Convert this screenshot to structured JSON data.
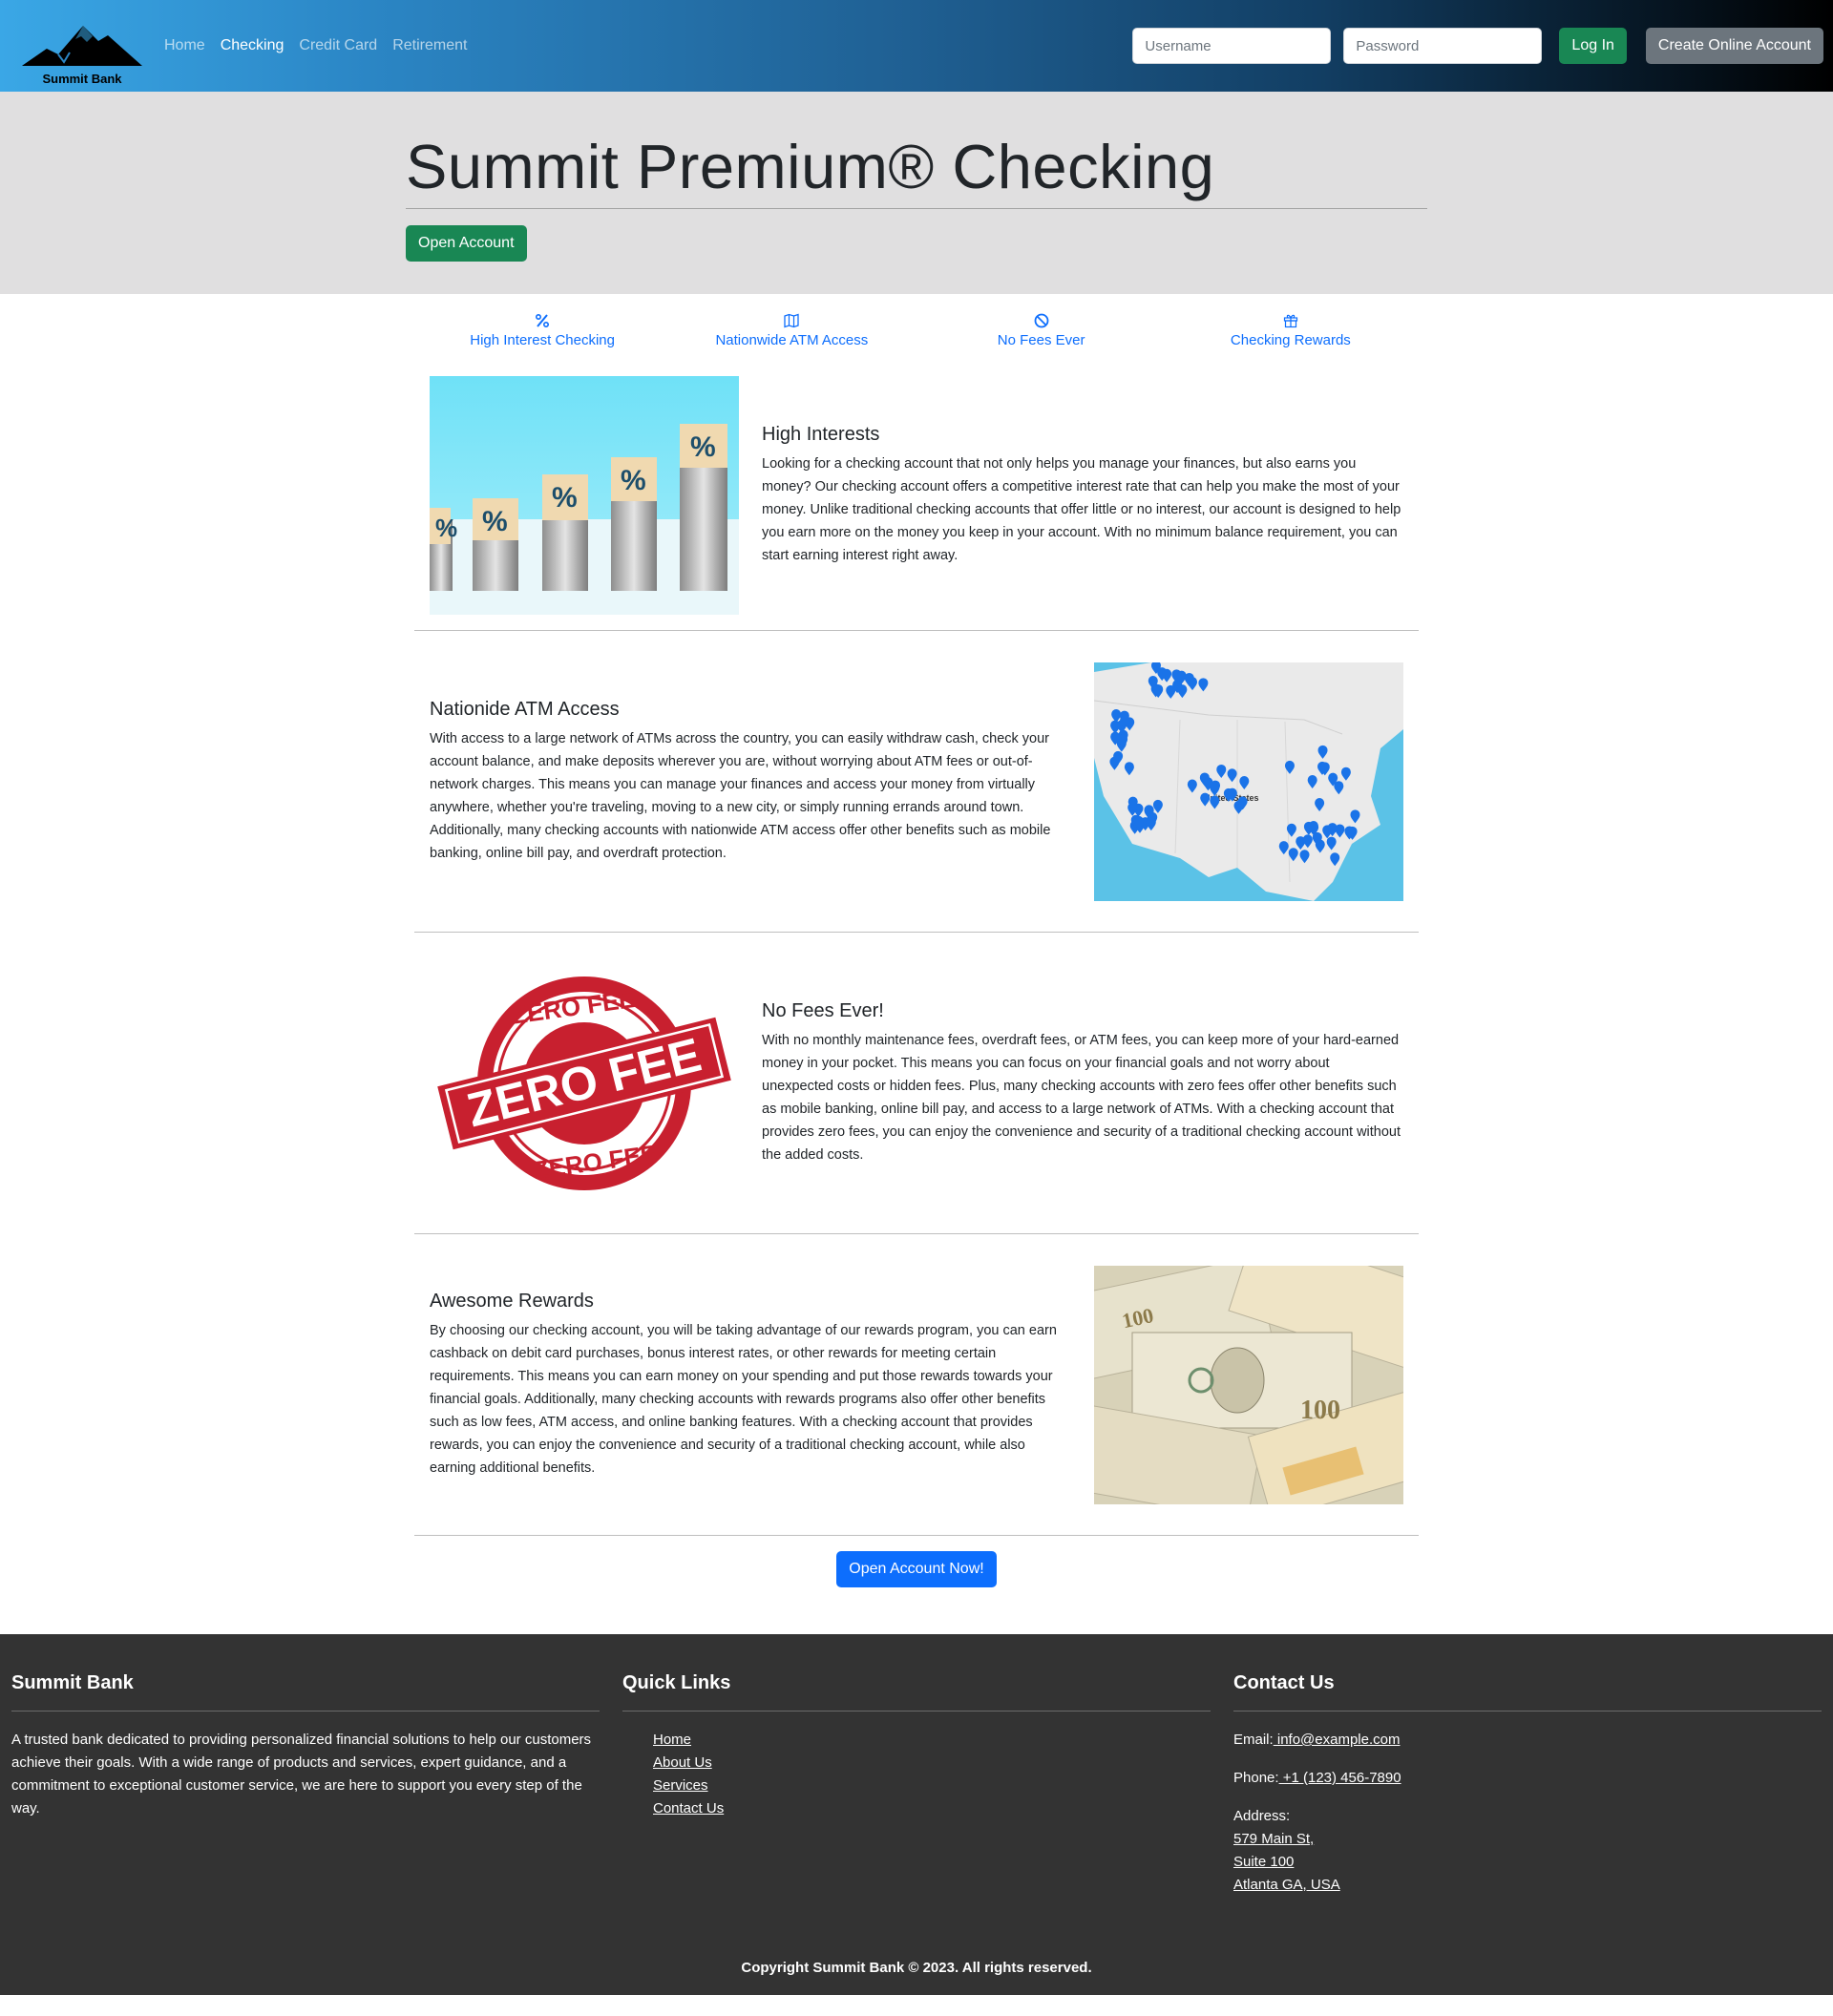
{
  "brand": {
    "name": "Summit Bank"
  },
  "nav": {
    "links": [
      {
        "label": "Home",
        "active": false
      },
      {
        "label": "Checking",
        "active": true
      },
      {
        "label": "Credit Card",
        "active": false
      },
      {
        "label": "Retirement",
        "active": false
      }
    ],
    "username_placeholder": "Username",
    "password_placeholder": "Password",
    "login_label": "Log In",
    "create_account_label": "Create Online Account"
  },
  "hero": {
    "title": "Summit Premium® Checking",
    "open_account_label": "Open Account"
  },
  "features": [
    {
      "label": "High Interest Checking",
      "icon": "percent-icon"
    },
    {
      "label": "Nationwide ATM Access",
      "icon": "map-icon"
    },
    {
      "label": "No Fees Ever",
      "icon": "ban-icon"
    },
    {
      "label": "Checking Rewards",
      "icon": "gift-icon"
    }
  ],
  "sections": [
    {
      "title": "High Interests",
      "body": "Looking for a checking account that not only helps you manage your finances, but also earns you money? Our checking account offers a competitive interest rate that can help you make the most of your money. Unlike traditional checking accounts that offer little or no interest, our account is designed to help you earn more on the money you keep in your account. With no minimum balance requirement, you can start earning interest right away.",
      "image": "coins-percent-image",
      "image_text": "%"
    },
    {
      "title": "Nationide ATM Access",
      "body": "With access to a large network of ATMs across the country, you can easily withdraw cash, check your account balance, and make deposits wherever you are, without worrying about ATM fees or out-of-network charges. This means you can manage your finances and access your money from virtually anywhere, whether you're traveling, moving to a new city, or simply running errands around town. Additionally, many checking accounts with nationwide ATM access offer other benefits such as mobile banking, online bill pay, and overdraft protection.",
      "image": "atm-map-image",
      "image_text": "United States"
    },
    {
      "title": "No Fees Ever!",
      "body": "With no monthly maintenance fees, overdraft fees, or ATM fees, you can keep more of your hard-earned money in your pocket. This means you can focus on your financial goals and not worry about unexpected costs or hidden fees. Plus, many checking accounts with zero fees offer other benefits such as mobile banking, online bill pay, and access to a large network of ATMs. With a checking account that provides zero fees, you can enjoy the convenience and security of a traditional checking account without the added costs.",
      "image": "zero-fee-stamp-image",
      "image_text": "ZERO FEE"
    },
    {
      "title": "Awesome Rewards",
      "body": "By choosing our checking account, you will be taking advantage of our rewards program, you can earn cashback on debit card purchases, bonus interest rates, or other rewards for meeting certain requirements. This means you can earn money on your spending and put those rewards towards your financial goals. Additionally, many checking accounts with rewards programs also offer other benefits such as low fees, ATM access, and online banking features. With a checking account that provides rewards, you can enjoy the convenience and security of a traditional checking account, while also earning additional benefits.",
      "image": "dollar-bills-image",
      "image_text": "100"
    }
  ],
  "cta": {
    "label": "Open Account Now!"
  },
  "footer": {
    "about_title": "Summit Bank",
    "about_text": "A trusted bank dedicated to providing personalized financial solutions to help our customers achieve their goals. With a wide range of products and services, expert guidance, and a commitment to exceptional customer service, we are here to support you every step of the way.",
    "links_title": "Quick Links",
    "links": [
      "Home",
      "About Us",
      "Services",
      "Contact Us"
    ],
    "contact_title": "Contact Us",
    "email_label": "Email:",
    "email": " info@example.com",
    "phone_label": "Phone:",
    "phone": " +1 (123) 456-7890",
    "address_label": "Address:",
    "address_lines": [
      "579 Main St,",
      "Suite 100",
      "Atlanta GA, USA"
    ],
    "copyright": "Copyright Summit Bank © 2023. All rights reserved."
  },
  "colors": {
    "primary": "#0d6efd",
    "success": "#198754",
    "secondary": "#6c757d",
    "footer_bg": "#333333",
    "hero_bg": "#e0dfe0"
  }
}
